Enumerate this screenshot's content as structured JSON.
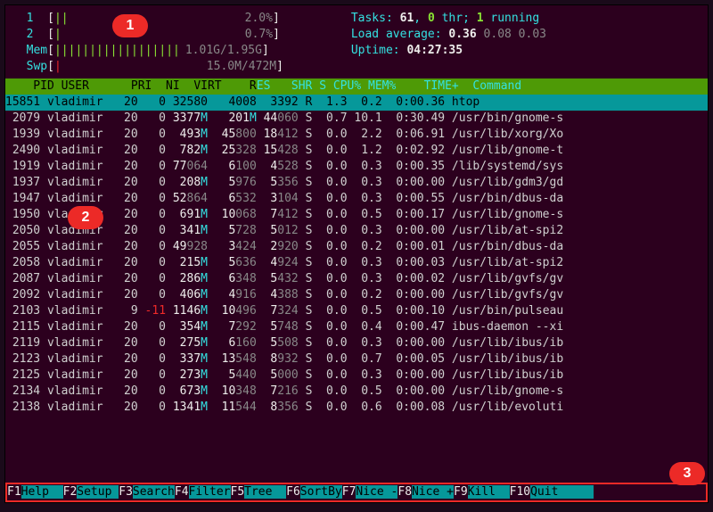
{
  "meters": {
    "cpu1": {
      "label": "1",
      "fill": "||",
      "pct": "2.0%"
    },
    "cpu2": {
      "label": "2",
      "fill": "|",
      "pct": "0.7%"
    },
    "mem": {
      "label": "Mem",
      "fill": "||||||||||||||||||",
      "text": "1.01G/1.95G"
    },
    "swp": {
      "label": "Swp",
      "fill": "|",
      "text": "15.0M/472M"
    }
  },
  "stats": {
    "tasks_label": "Tasks: ",
    "tasks_total": "61",
    "tasks_sep1": ", ",
    "tasks_thr": "0",
    "tasks_thr_label": " thr; ",
    "tasks_running": "1",
    "tasks_running_label": " running",
    "load_label": "Load average: ",
    "load1": "0.36",
    "load2": " 0.08",
    "load3": " 0.03",
    "uptime_label": "Uptime: ",
    "uptime": "04:27:35"
  },
  "columns": {
    "pid": "PID",
    "user": "USER",
    "pri": "PRI",
    "ni": "NI",
    "virt": "VIRT",
    "res": "RES",
    "shr": "SHR",
    "s": "S",
    "cpu": "CPU%",
    "mem": "MEM%",
    "time": "TIME+",
    "cmd": "Command"
  },
  "processes": [
    {
      "pid": "15851",
      "user": "vladimir",
      "pri": "20",
      "ni": "0",
      "virt": "32580",
      "res": "4008",
      "shr": "3392",
      "s": "R",
      "cpu": "1.3",
      "mem": "0.2",
      "time": "0:00.36",
      "cmd": "htop",
      "sel": true
    },
    {
      "pid": "2079",
      "user": "vladimir",
      "pri": "20",
      "ni": "0",
      "virt": "3377",
      "virt_u": "M",
      "res": "201",
      "res_u": "M",
      "shr": "44",
      "shr2": "060",
      "s": "S",
      "cpu": "0.7",
      "mem": "10.1",
      "time": "0:30.49",
      "cmd": "/usr/bin/gnome-s"
    },
    {
      "pid": "1939",
      "user": "vladimir",
      "pri": "20",
      "ni": "0",
      "virt": "493",
      "virt_u": "M",
      "res": "45",
      "res2": "800",
      "shr": "18",
      "shr2": "412",
      "s": "S",
      "cpu": "0.0",
      "mem": "2.2",
      "time": "0:06.91",
      "cmd": "/usr/lib/xorg/Xo"
    },
    {
      "pid": "2490",
      "user": "vladimir",
      "pri": "20",
      "ni": "0",
      "virt": "782",
      "virt_u": "M",
      "res": "25",
      "res2": "328",
      "shr": "15",
      "shr2": "428",
      "s": "S",
      "cpu": "0.0",
      "mem": "1.2",
      "time": "0:02.92",
      "cmd": "/usr/lib/gnome-t"
    },
    {
      "pid": "1919",
      "user": "vladimir",
      "pri": "20",
      "ni": "0",
      "virt": "77",
      "virt2": "064",
      "res": "6",
      "res2": "100",
      "shr": "4",
      "shr2": "528",
      "s": "S",
      "cpu": "0.0",
      "mem": "0.3",
      "time": "0:00.35",
      "cmd": "/lib/systemd/sys"
    },
    {
      "pid": "1937",
      "user": "vladimir",
      "pri": "20",
      "ni": "0",
      "virt": "208",
      "virt_u": "M",
      "res": "5",
      "res2": "976",
      "shr": "5",
      "shr2": "356",
      "s": "S",
      "cpu": "0.0",
      "mem": "0.3",
      "time": "0:00.00",
      "cmd": "/usr/lib/gdm3/gd"
    },
    {
      "pid": "1947",
      "user": "vladimir",
      "pri": "20",
      "ni": "0",
      "virt": "52",
      "virt2": "864",
      "res": "6",
      "res2": "532",
      "shr": "3",
      "shr2": "104",
      "s": "S",
      "cpu": "0.0",
      "mem": "0.3",
      "time": "0:00.55",
      "cmd": "/usr/bin/dbus-da"
    },
    {
      "pid": "1950",
      "user": "vladimir",
      "pri": "20",
      "ni": "0",
      "virt": "691",
      "virt_u": "M",
      "res": "10",
      "res2": "068",
      "shr": "7",
      "shr2": "412",
      "s": "S",
      "cpu": "0.0",
      "mem": "0.5",
      "time": "0:00.17",
      "cmd": "/usr/lib/gnome-s"
    },
    {
      "pid": "2050",
      "user": "vladimir",
      "pri": "20",
      "ni": "0",
      "virt": "341",
      "virt_u": "M",
      "res": "5",
      "res2": "728",
      "shr": "5",
      "shr2": "012",
      "s": "S",
      "cpu": "0.0",
      "mem": "0.3",
      "time": "0:00.00",
      "cmd": "/usr/lib/at-spi2"
    },
    {
      "pid": "2055",
      "user": "vladimir",
      "pri": "20",
      "ni": "0",
      "virt": "49",
      "virt2": "928",
      "res": "3",
      "res2": "424",
      "shr": "2",
      "shr2": "920",
      "s": "S",
      "cpu": "0.0",
      "mem": "0.2",
      "time": "0:00.01",
      "cmd": "/usr/bin/dbus-da"
    },
    {
      "pid": "2058",
      "user": "vladimir",
      "pri": "20",
      "ni": "0",
      "virt": "215",
      "virt_u": "M",
      "res": "5",
      "res2": "636",
      "shr": "4",
      "shr2": "924",
      "s": "S",
      "cpu": "0.0",
      "mem": "0.3",
      "time": "0:00.03",
      "cmd": "/usr/lib/at-spi2"
    },
    {
      "pid": "2087",
      "user": "vladimir",
      "pri": "20",
      "ni": "0",
      "virt": "286",
      "virt_u": "M",
      "res": "6",
      "res2": "348",
      "shr": "5",
      "shr2": "432",
      "s": "S",
      "cpu": "0.0",
      "mem": "0.3",
      "time": "0:00.02",
      "cmd": "/usr/lib/gvfs/gv"
    },
    {
      "pid": "2092",
      "user": "vladimir",
      "pri": "20",
      "ni": "0",
      "virt": "406",
      "virt_u": "M",
      "res": "4",
      "res2": "916",
      "shr": "4",
      "shr2": "388",
      "s": "S",
      "cpu": "0.0",
      "mem": "0.2",
      "time": "0:00.00",
      "cmd": "/usr/lib/gvfs/gv"
    },
    {
      "pid": "2103",
      "user": "vladimir",
      "pri": "9",
      "ni": "-11",
      "virt": "1146",
      "virt_u": "M",
      "res": "10",
      "res2": "496",
      "shr": "7",
      "shr2": "324",
      "s": "S",
      "cpu": "0.0",
      "mem": "0.5",
      "time": "0:00.10",
      "cmd": "/usr/bin/pulseau"
    },
    {
      "pid": "2115",
      "user": "vladimir",
      "pri": "20",
      "ni": "0",
      "virt": "354",
      "virt_u": "M",
      "res": "7",
      "res2": "292",
      "shr": "5",
      "shr2": "748",
      "s": "S",
      "cpu": "0.0",
      "mem": "0.4",
      "time": "0:00.47",
      "cmd": "ibus-daemon --xi"
    },
    {
      "pid": "2119",
      "user": "vladimir",
      "pri": "20",
      "ni": "0",
      "virt": "275",
      "virt_u": "M",
      "res": "6",
      "res2": "160",
      "shr": "5",
      "shr2": "508",
      "s": "S",
      "cpu": "0.0",
      "mem": "0.3",
      "time": "0:00.00",
      "cmd": "/usr/lib/ibus/ib"
    },
    {
      "pid": "2123",
      "user": "vladimir",
      "pri": "20",
      "ni": "0",
      "virt": "337",
      "virt_u": "M",
      "res": "13",
      "res2": "548",
      "shr": "8",
      "shr2": "932",
      "s": "S",
      "cpu": "0.0",
      "mem": "0.7",
      "time": "0:00.05",
      "cmd": "/usr/lib/ibus/ib"
    },
    {
      "pid": "2125",
      "user": "vladimir",
      "pri": "20",
      "ni": "0",
      "virt": "273",
      "virt_u": "M",
      "res": "5",
      "res2": "440",
      "shr": "5",
      "shr2": "000",
      "s": "S",
      "cpu": "0.0",
      "mem": "0.3",
      "time": "0:00.00",
      "cmd": "/usr/lib/ibus/ib"
    },
    {
      "pid": "2134",
      "user": "vladimir",
      "pri": "20",
      "ni": "0",
      "virt": "673",
      "virt_u": "M",
      "res": "10",
      "res2": "348",
      "shr": "7",
      "shr2": "216",
      "s": "S",
      "cpu": "0.0",
      "mem": "0.5",
      "time": "0:00.00",
      "cmd": "/usr/lib/gnome-s"
    },
    {
      "pid": "2138",
      "user": "vladimir",
      "pri": "20",
      "ni": "0",
      "virt": "1341",
      "virt_u": "M",
      "res": "11",
      "res2": "544",
      "shr": "8",
      "shr2": "356",
      "s": "S",
      "cpu": "0.0",
      "mem": "0.6",
      "time": "0:00.08",
      "cmd": "/usr/lib/evoluti"
    }
  ],
  "footer": [
    {
      "k": "F1",
      "l": "Help  "
    },
    {
      "k": "F2",
      "l": "Setup "
    },
    {
      "k": "F3",
      "l": "Search"
    },
    {
      "k": "F4",
      "l": "Filter"
    },
    {
      "k": "F5",
      "l": "Tree  "
    },
    {
      "k": "F6",
      "l": "SortBy"
    },
    {
      "k": "F7",
      "l": "Nice -"
    },
    {
      "k": "F8",
      "l": "Nice +"
    },
    {
      "k": "F9",
      "l": "Kill  "
    },
    {
      "k": "F10",
      "l": "Quit "
    }
  ],
  "callouts": {
    "a": "1",
    "b": "2",
    "c": "3"
  }
}
